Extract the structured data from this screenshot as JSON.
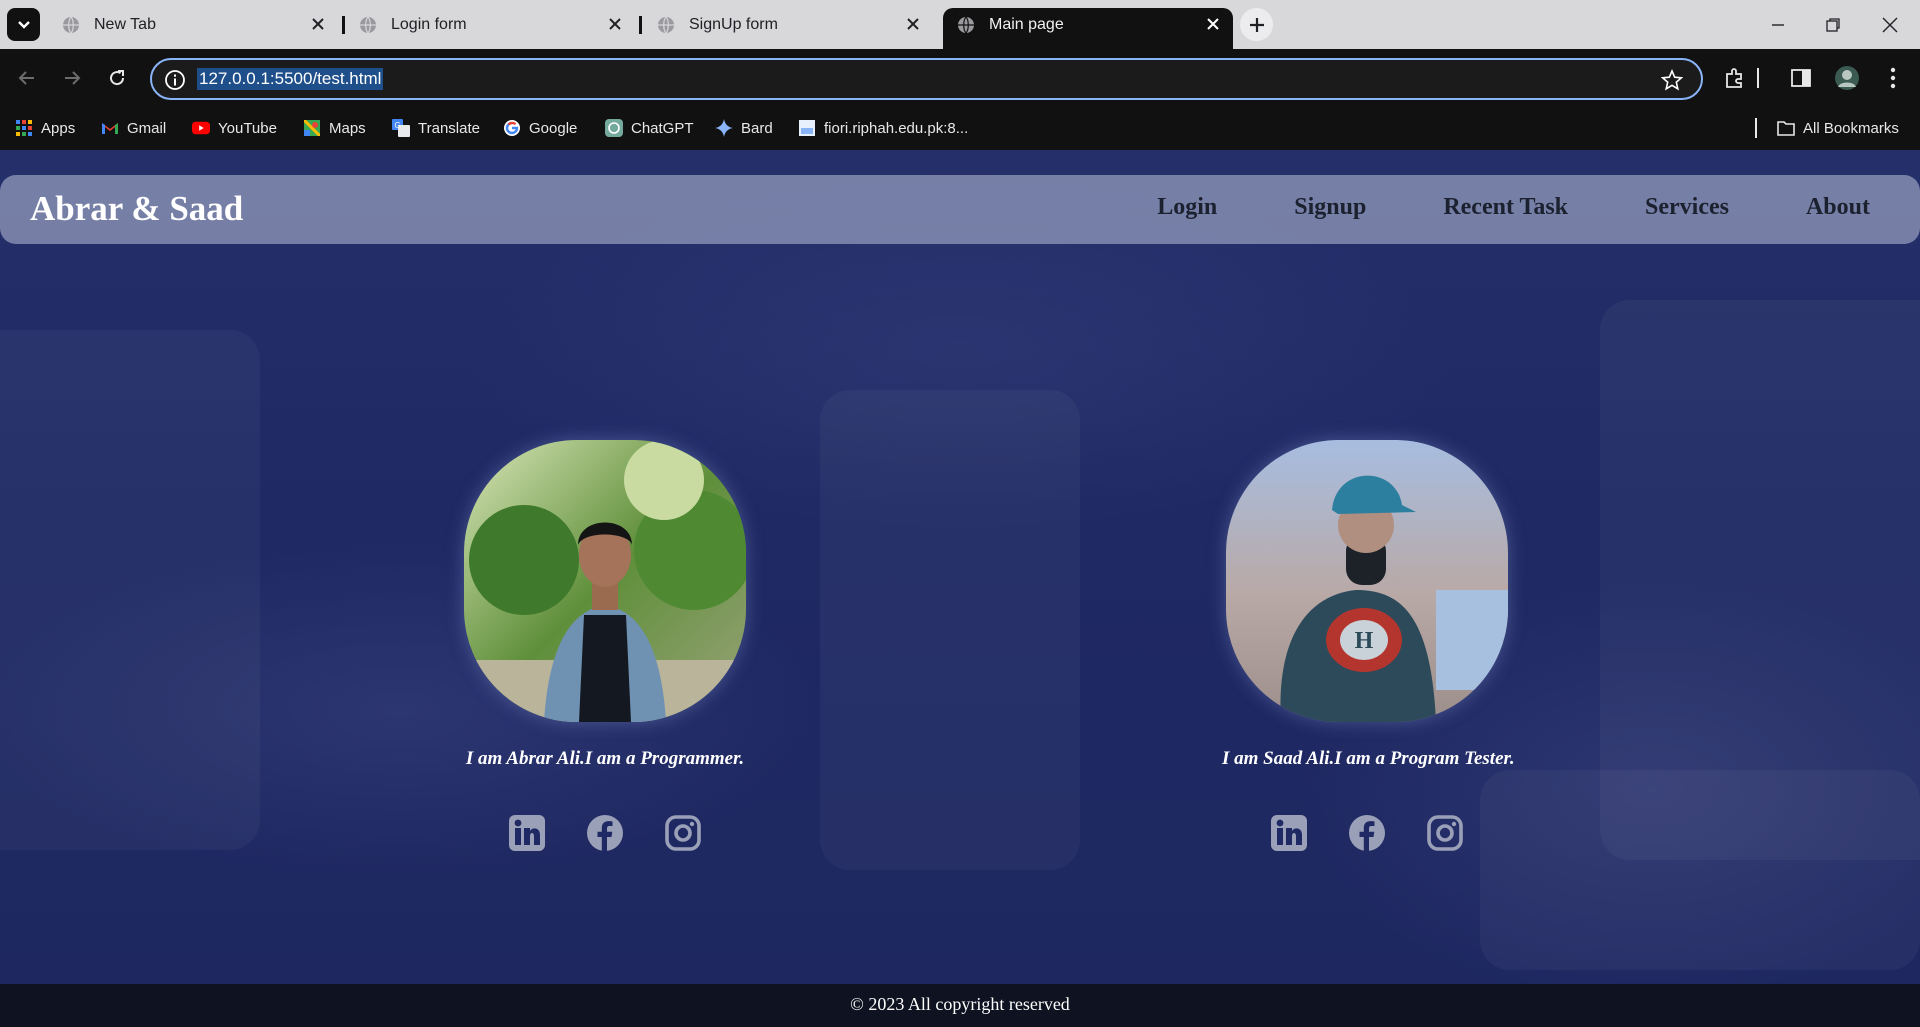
{
  "browser": {
    "tabs": [
      {
        "title": "New Tab",
        "active": false
      },
      {
        "title": "Login form",
        "active": false
      },
      {
        "title": "SignUp form",
        "active": false
      },
      {
        "title": "Main page",
        "active": true
      }
    ],
    "url": "127.0.0.1:5500/test.html",
    "bookmarks": [
      {
        "label": "Apps",
        "icon": "apps-grid-icon"
      },
      {
        "label": "Gmail",
        "icon": "gmail-icon"
      },
      {
        "label": "YouTube",
        "icon": "youtube-icon"
      },
      {
        "label": "Maps",
        "icon": "maps-icon"
      },
      {
        "label": "Translate",
        "icon": "translate-icon"
      },
      {
        "label": "Google",
        "icon": "google-icon"
      },
      {
        "label": "ChatGPT",
        "icon": "chatgpt-icon"
      },
      {
        "label": "Bard",
        "icon": "bard-icon"
      },
      {
        "label": "fiori.riphah.edu.pk:8...",
        "icon": "page-icon"
      }
    ],
    "all_bookmarks": "All Bookmarks"
  },
  "site": {
    "brand": "Abrar & Saad",
    "nav": [
      "Login",
      "Signup",
      "Recent Task",
      "Services",
      "About"
    ],
    "cards": [
      {
        "caption": "I am Abrar Ali.I am a Programmer.",
        "socials": [
          "linkedin-icon",
          "facebook-icon",
          "instagram-icon"
        ]
      },
      {
        "caption": "I am Saad Ali.I am a Program Tester.",
        "socials": [
          "linkedin-icon",
          "facebook-icon",
          "instagram-icon"
        ]
      }
    ],
    "footer": "© 2023 All copyright reserved"
  },
  "colors": {
    "page_bg": "#1f2963",
    "navbar_bg": "#969ebe",
    "social_icon": "#9aa0b8",
    "footer_bg": "#0f1220"
  }
}
